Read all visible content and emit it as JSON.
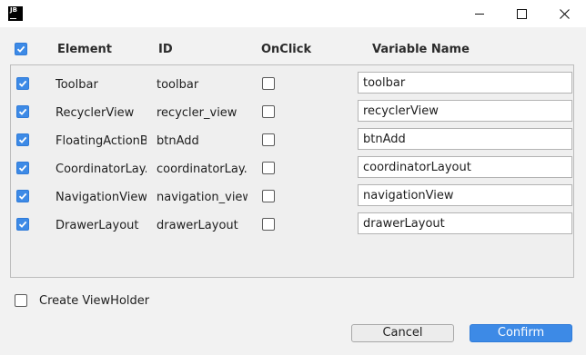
{
  "titlebar": {
    "logo_text": "JB",
    "minimize_icon": "minimize-icon",
    "maximize_icon": "maximize-icon",
    "close_icon": "close-icon"
  },
  "header": {
    "select_all_checked": true,
    "columns": [
      "Element",
      "ID",
      "OnClick",
      "Variable Name"
    ]
  },
  "rows": [
    {
      "checked": true,
      "element": "Toolbar",
      "id": "toolbar",
      "onclick": false,
      "variable": "toolbar"
    },
    {
      "checked": true,
      "element": "RecyclerView",
      "id": "recycler_view",
      "onclick": false,
      "variable": "recyclerView"
    },
    {
      "checked": true,
      "element": "FloatingActionB...",
      "id": "btnAdd",
      "onclick": false,
      "variable": "btnAdd"
    },
    {
      "checked": true,
      "element": "CoordinatorLay...",
      "id": "coordinatorLay...",
      "onclick": false,
      "variable": "coordinatorLayout"
    },
    {
      "checked": true,
      "element": "NavigationView",
      "id": "navigation_view",
      "onclick": false,
      "variable": "navigationView"
    },
    {
      "checked": true,
      "element": "DrawerLayout",
      "id": "drawerLayout",
      "onclick": false,
      "variable": "drawerLayout"
    }
  ],
  "footer": {
    "create_viewholder_label": "Create ViewHolder",
    "create_viewholder_checked": false,
    "cancel_label": "Cancel",
    "confirm_label": "Confirm"
  },
  "colors": {
    "accent": "#3d8ae6",
    "background": "#f2f2f2"
  }
}
